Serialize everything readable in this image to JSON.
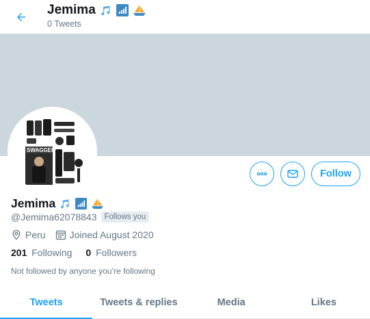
{
  "header": {
    "name": "Jemima",
    "tweet_count": "0 Tweets"
  },
  "profile": {
    "name": "Jemima",
    "handle": "@Jemima62078843",
    "follows_you": "Follows you",
    "location": "Peru",
    "joined": "Joined August 2020",
    "following_count": "201",
    "following_label": "Following",
    "followers_count": "0",
    "followers_label": "Followers",
    "not_followed": "Not followed by anyone you’re following"
  },
  "actions": {
    "follow_label": "Follow"
  },
  "tabs": [
    {
      "label": "Tweets"
    },
    {
      "label": "Tweets & replies"
    },
    {
      "label": "Media"
    },
    {
      "label": "Likes"
    }
  ],
  "name_icons": [
    "musical-notes-icon",
    "signal-bars-icon",
    "sailboat-icon"
  ],
  "colors": {
    "accent": "#1da1f2",
    "banner": "#ccd6dd",
    "secondary_text": "#657786"
  }
}
